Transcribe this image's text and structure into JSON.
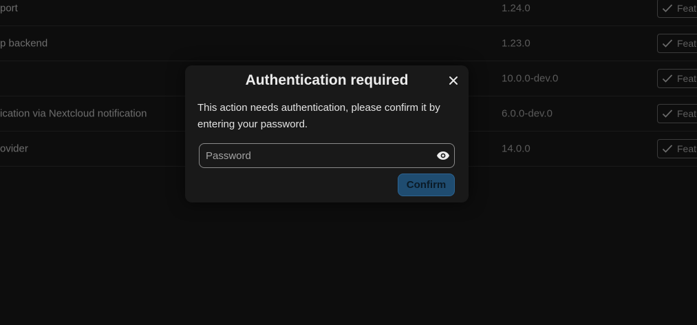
{
  "app_list": {
    "rows": [
      {
        "name": "port",
        "version": "1.24.0",
        "badge": "Featured"
      },
      {
        "name": "p backend",
        "version": "1.23.0",
        "badge": "Featured"
      },
      {
        "name": "",
        "version": "10.0.0-dev.0",
        "badge": "Featured"
      },
      {
        "name": "ication via Nextcloud notification",
        "version": "6.0.0-dev.0",
        "badge": "Featured"
      },
      {
        "name": "ovider",
        "version": "14.0.0",
        "badge": "Featured"
      }
    ]
  },
  "dialog": {
    "title": "Authentication required",
    "description": "This action needs authentication, please confirm it by entering your password.",
    "password": {
      "placeholder": "Password",
      "value": ""
    },
    "confirm_label": "Confirm",
    "close_icon": "close-icon",
    "visibility_icon": "eye-icon"
  },
  "colors": {
    "background": "#0d0d0d",
    "dialog_background": "#191919",
    "primary": "#1f4c70"
  }
}
